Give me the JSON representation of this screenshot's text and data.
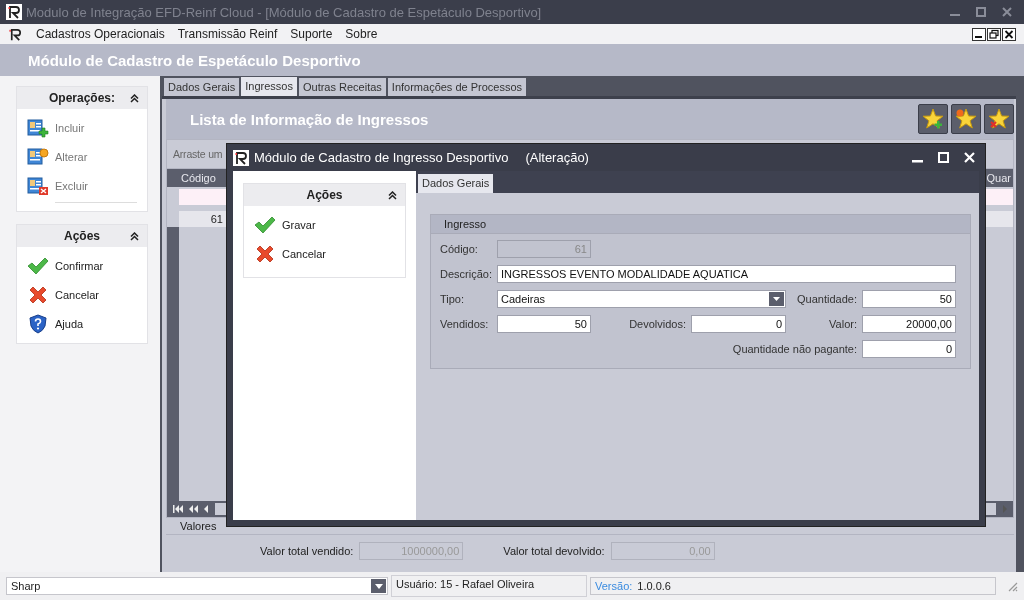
{
  "window": {
    "title": "Modulo de Integração EFD-Reinf Cloud - [Módulo de Cadastro de Espetáculo Desportivo]"
  },
  "menu": [
    {
      "label": "Cadastros Operacionais"
    },
    {
      "label": "Transmissão Reinf"
    },
    {
      "label": "Suporte"
    },
    {
      "label": "Sobre"
    }
  ],
  "header": {
    "title": "Módulo de Cadastro de Espetáculo Desportivo"
  },
  "side_panels": [
    {
      "title": "Operações:",
      "expanded": true,
      "items": [
        {
          "label": "Incluir",
          "kind": "add",
          "disabled": true
        },
        {
          "label": "Alterar",
          "kind": "edit",
          "disabled": true
        },
        {
          "label": "Excluir",
          "kind": "delete",
          "disabled": true
        }
      ]
    },
    {
      "title": "Ações",
      "expanded": true,
      "items": [
        {
          "label": "Confirmar",
          "kind": "confirm",
          "disabled": false
        },
        {
          "label": "Cancelar",
          "kind": "cancel",
          "disabled": false
        },
        {
          "label": "Ajuda",
          "kind": "help",
          "disabled": false
        }
      ]
    }
  ],
  "tabs": [
    {
      "label": "Dados Gerais",
      "selected": false
    },
    {
      "label": "Ingressos",
      "selected": true
    },
    {
      "label": "Outras Receitas",
      "selected": false
    },
    {
      "label": "Informações de Processos",
      "selected": false
    }
  ],
  "list": {
    "title": "Lista de Informação de Ingressos",
    "toolbar": [
      {
        "kind": "add"
      },
      {
        "kind": "edit"
      },
      {
        "kind": "delete"
      }
    ],
    "group_hint": "Arraste um",
    "columns": [
      {
        "label": "Código"
      },
      {
        "label": "Quar"
      }
    ],
    "rows": [
      [
        "61"
      ]
    ]
  },
  "totals": {
    "title": "Valores",
    "fields": [
      {
        "label": "Valor total vendido:",
        "value": "1000000,00",
        "disabled": true
      },
      {
        "label": "Valor total devolvido:",
        "value": "0,00",
        "disabled": true
      }
    ]
  },
  "dialog": {
    "title": "Módulo de Cadastro de Ingresso Desportivo",
    "mode": "(Alteração)",
    "actions": {
      "title": "Ações",
      "expanded": true,
      "items": [
        {
          "label": "Gravar",
          "kind": "confirm"
        },
        {
          "label": "Cancelar",
          "kind": "cancel"
        }
      ]
    },
    "tabs": [
      {
        "label": "Dados Gerais",
        "selected": true
      }
    ],
    "group": {
      "title": "Ingresso",
      "fields": [
        {
          "label": "Código:",
          "value": "61",
          "kind": "number",
          "disabled": true
        },
        {
          "label": "Descrição:",
          "value": "INGRESSOS EVENTO MODALIDADE AQUATICA",
          "kind": "text",
          "disabled": false
        },
        {
          "label": "Tipo:",
          "value": "Cadeiras",
          "kind": "dropdown",
          "disabled": false
        },
        {
          "label": "Quantidade:",
          "value": "50",
          "kind": "number",
          "disabled": false
        },
        {
          "label": "Vendidos:",
          "value": "50",
          "kind": "number",
          "disabled": false
        },
        {
          "label": "Devolvidos:",
          "value": "0",
          "kind": "number",
          "disabled": false
        },
        {
          "label": "Valor:",
          "value": "20000,00",
          "kind": "number",
          "disabled": false
        },
        {
          "label": "Quantidade não pagante:",
          "value": "0",
          "kind": "number",
          "disabled": false
        }
      ]
    }
  },
  "status_bar": {
    "combo": "Sharp",
    "user": "Usuário: 15 - Rafael Oliveira",
    "version_label": "Versão:",
    "version": "1.0.0.6"
  }
}
